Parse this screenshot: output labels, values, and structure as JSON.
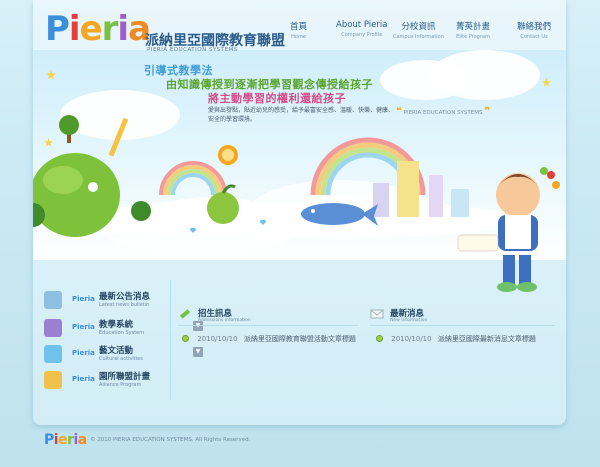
{
  "brand": {
    "logo_letters": [
      "P",
      "i",
      "e",
      "r",
      "i",
      "a"
    ],
    "name_cn": "派納里亞國際教育聯盟",
    "name_en": "PIERIA EDUCATION SYSTEMS"
  },
  "nav": [
    {
      "cn": "首頁",
      "en": "Home"
    },
    {
      "cn": "About Pieria",
      "en": "Company Profile"
    },
    {
      "cn": "分校資訊",
      "en": "Campus Information"
    },
    {
      "cn": "菁英計畫",
      "en": "Elite Program"
    },
    {
      "cn": "聯絡我們",
      "en": "Contact Us"
    }
  ],
  "hero": {
    "slogan_1": "引導式教學法",
    "slogan_2": "由知識傳授到逐漸把學習觀念傳授給孩子",
    "slogan_3": "將主動學習的權利還給孩子",
    "description": "愛與出發點，貼近幼兒的感受，給予最富安全感、溫暖、快樂、健康、安全的學習環境。",
    "quote_text": "PIERIA EDUCATION SYSTEMS",
    "quote_open": "❝",
    "quote_close": "❞"
  },
  "sidebar_menu": [
    {
      "brand": "Pieria",
      "cn": "最新公告消息",
      "en": "Latest news bulletin",
      "has_arrow": false,
      "arrow": ""
    },
    {
      "brand": "Pieria",
      "cn": "教學系統",
      "en": "Education System",
      "has_arrow": true,
      "arrow": "▼"
    },
    {
      "brand": "Pieria",
      "cn": "藝文活動",
      "en": "Cultural activities",
      "has_arrow": true,
      "arrow": "▼"
    },
    {
      "brand": "Pieria",
      "cn": "園所聯盟計畫",
      "en": "Alliance Program",
      "has_arrow": false,
      "arrow": ""
    }
  ],
  "admissions": {
    "title_cn": "招生訊息",
    "title_en": "Admissions information",
    "items": [
      {
        "date": "2010/10/10",
        "title": "派納里亞國際教育聯盟活動文章標題"
      }
    ]
  },
  "latest_news": {
    "title_cn": "最新消息",
    "title_en": "New Information",
    "items": [
      {
        "date": "2010/10/10",
        "title": "派納里亞國際最新消息文章標題"
      }
    ]
  },
  "footer": {
    "logo_letters": [
      "P",
      "i",
      "e",
      "r",
      "i",
      "a"
    ],
    "copyright": "© 2010 PIERIA EDUCATION SYSTEMS. All Rights Reserved."
  },
  "colors": {
    "primary_text": "#2b5b8a",
    "slogan_blue": "#3f9dd6",
    "slogan_green": "#5aa52d",
    "slogan_pink": "#d94c8a",
    "accent_green": "#9fcf4f"
  }
}
